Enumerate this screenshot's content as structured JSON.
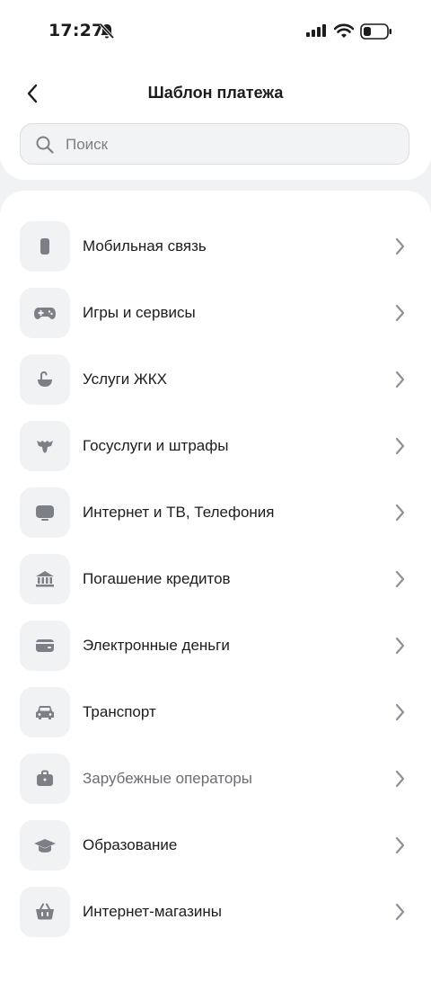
{
  "status_bar": {
    "time": "17:27"
  },
  "header": {
    "title": "Шаблон платежа"
  },
  "search": {
    "placeholder": "Поиск"
  },
  "colors": {
    "icon": "#7d7f86",
    "icon_bg": "#f1f2f4",
    "chevron": "#8e9096"
  },
  "categories": [
    {
      "label": "Мобильная связь",
      "icon": "phone-icon"
    },
    {
      "label": "Игры и сервисы",
      "icon": "gamepad-icon"
    },
    {
      "label": "Услуги ЖКХ",
      "icon": "faucet-icon"
    },
    {
      "label": "Госуслуги и штрафы",
      "icon": "coat-of-arms-icon"
    },
    {
      "label": "Интернет и ТВ, Телефония",
      "icon": "tv-icon"
    },
    {
      "label": "Погашение кредитов",
      "icon": "bank-icon"
    },
    {
      "label": "Электронные деньги",
      "icon": "wallet-icon"
    },
    {
      "label": "Транспорт",
      "icon": "car-icon"
    },
    {
      "label": "Зарубежные операторы",
      "icon": "briefcase-icon"
    },
    {
      "label": "Образование",
      "icon": "graduation-cap-icon"
    },
    {
      "label": "Интернет-магазины",
      "icon": "basket-icon"
    }
  ]
}
